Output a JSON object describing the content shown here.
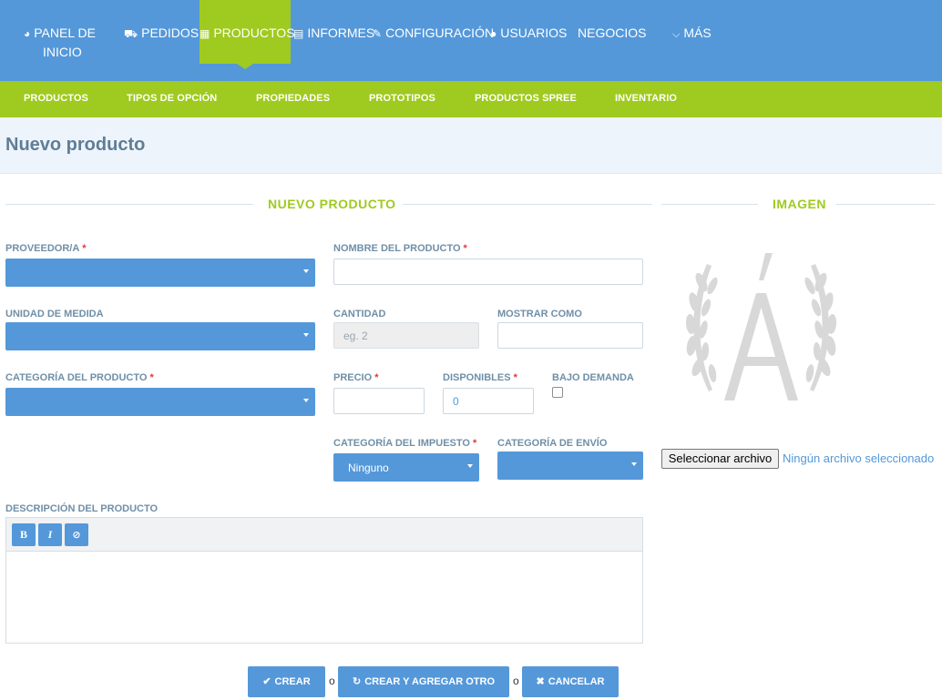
{
  "topnav": {
    "items": [
      {
        "icon": "dashboard-icon",
        "glyph": "◕",
        "line1": "PANEL DE",
        "line2": "INICIO"
      },
      {
        "icon": "cart-icon",
        "glyph": "🛒",
        "label": "PEDIDOS"
      },
      {
        "icon": "grid-icon",
        "glyph": "▦",
        "label": "PRODUCTOS"
      },
      {
        "icon": "file-icon",
        "glyph": "🗎",
        "label": "INFORMES"
      },
      {
        "icon": "wrench-icon",
        "glyph": "🔧",
        "label": "CONFIGURACIÓN"
      },
      {
        "icon": "user-icon",
        "glyph": "👤",
        "label": "USUARIOS"
      },
      {
        "label": "NEGOCIOS"
      },
      {
        "icon": "chevron-down-icon",
        "glyph": "⌄",
        "label": "MÁS"
      }
    ],
    "active": "PRODUCTOS"
  },
  "subnav": {
    "items": [
      "PRODUCTOS",
      "TIPOS DE OPCIÓN",
      "PROPIEDADES",
      "PROTOTIPOS",
      "PRODUCTOS SPREE",
      "INVENTARIO"
    ]
  },
  "page": {
    "title": "Nuevo producto"
  },
  "sections": {
    "product": "NUEVO PRODUCTO",
    "image": "IMAGEN"
  },
  "form": {
    "supplier": {
      "label": "PROVEEDOR/A",
      "required": "*",
      "value": ""
    },
    "name": {
      "label": "NOMBRE DEL PRODUCTO",
      "required": "*",
      "value": ""
    },
    "unit": {
      "label": "UNIDAD DE MEDIDA",
      "value": ""
    },
    "quantity": {
      "label": "CANTIDAD",
      "placeholder": "eg. 2"
    },
    "display_as": {
      "label": "MOSTRAR COMO",
      "value": ""
    },
    "category": {
      "label": "CATEGORÍA DEL PRODUCTO",
      "required": "*",
      "value": ""
    },
    "price": {
      "label": "PRECIO",
      "required": "*",
      "value": ""
    },
    "available": {
      "label": "DISPONIBLES",
      "required": "*",
      "value": "0"
    },
    "on_demand": {
      "label": "BAJO DEMANDA",
      "checked": false
    },
    "tax_category": {
      "label": "CATEGORÍA DEL IMPUESTO",
      "required": "*",
      "value": "Ninguno"
    },
    "shipping_category": {
      "label": "CATEGORÍA DE ENVÍO",
      "value": ""
    },
    "description": {
      "label": "DESCRIPCIÓN DEL PRODUCTO",
      "bold": "B",
      "italic": "I",
      "clear": "⊘"
    }
  },
  "image": {
    "choose_button": "Seleccionar archivo",
    "no_file": "Ningún archivo seleccionado"
  },
  "actions": {
    "create": "CREAR",
    "create_icon": "✔",
    "create_another": "CREAR Y AGREGAR OTRO",
    "create_another_icon": "↻",
    "cancel": "CANCELAR",
    "cancel_icon": "✖",
    "or": "o"
  },
  "colors": {
    "primary": "#5498da",
    "accent": "#9fca1f",
    "required": "#e5343d",
    "label": "#6f8fa8"
  }
}
